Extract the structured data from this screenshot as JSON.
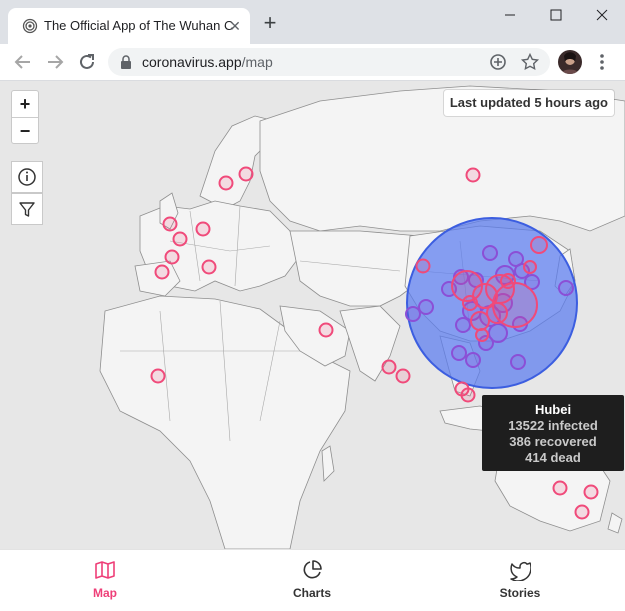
{
  "browser": {
    "tab_title": "The Official App of The Wuhan Co",
    "new_tab_label": "+",
    "url_host": "coronavirus.app",
    "url_path": "/map",
    "window_controls": [
      "minimize-icon",
      "maximize-icon",
      "close-icon"
    ]
  },
  "map": {
    "last_updated": "Last updated 5 hours ago",
    "zoom_in": "+",
    "zoom_out": "−",
    "infected_color": "#f04a7a",
    "recovered_color": "#8b4fd6",
    "hubei_color": "#5a7cf0"
  },
  "tooltip": {
    "region": "Hubei",
    "infected": "13522 infected",
    "recovered": "386 recovered",
    "dead": "414 dead"
  },
  "bottom_nav": {
    "items": [
      {
        "label": "Map",
        "icon": "map-icon",
        "active": true
      },
      {
        "label": "Charts",
        "icon": "pie-chart-icon",
        "active": false
      },
      {
        "label": "Stories",
        "icon": "twitter-icon",
        "active": false
      }
    ]
  }
}
